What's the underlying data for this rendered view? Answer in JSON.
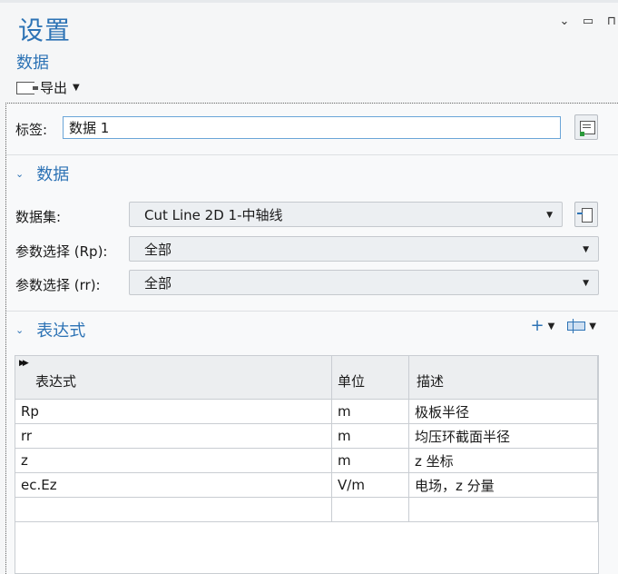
{
  "window": {
    "title": "设置",
    "controls": [
      {
        "name": "dropdown-icon",
        "glyph": "⌄"
      },
      {
        "name": "maximize-icon",
        "glyph": "▭"
      },
      {
        "name": "pin-icon",
        "glyph": "⊓"
      }
    ]
  },
  "header": {
    "subtitle": "数据",
    "export_label": "导出"
  },
  "label_row": {
    "label": "标签:",
    "value": "数据 1"
  },
  "data_section": {
    "title": "数据",
    "dataset_label": "数据集:",
    "dataset_value": "Cut Line 2D 1-中轴线",
    "param_rp_label": "参数选择 (Rp):",
    "param_rp_value": "全部",
    "param_rr_label": "参数选择 (rr):",
    "param_rr_value": "全部"
  },
  "expressions_section": {
    "title": "表达式",
    "columns": [
      "表达式",
      "单位",
      "描述"
    ],
    "rows": [
      {
        "expr": "Rp",
        "unit": "m",
        "desc": "极板半径"
      },
      {
        "expr": "rr",
        "unit": "m",
        "desc": "均压环截面半径"
      },
      {
        "expr": "z",
        "unit": "m",
        "desc": "z 坐标"
      },
      {
        "expr": "ec.Ez",
        "unit": "V/m",
        "desc": "电场，z 分量"
      }
    ]
  },
  "colors": {
    "accent": "#2d73b5",
    "input_border": "#6aa5d8"
  }
}
